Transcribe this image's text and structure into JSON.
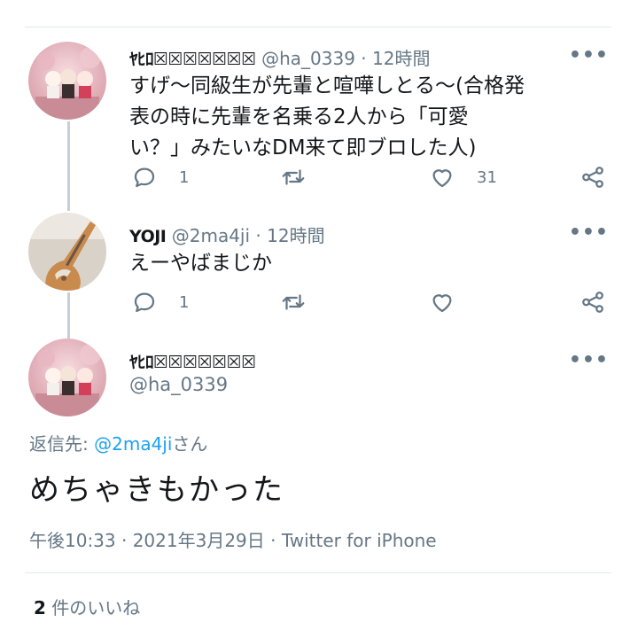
{
  "tweets": [
    {
      "display_name": "ﾔﾋﾛ☒☒☒☒☒☒☒",
      "handle": "@ha_0339",
      "time": "· 12時間",
      "more": "•••",
      "text": [
        "すげ〜同級生が先輩と喧嘩しとる〜(合格発",
        "表の時に先輩を名乗る2人から「可愛",
        "い？」みたいなDM来て即ブロした人)"
      ],
      "reply_count": "1",
      "like_count": "31",
      "avatar": "figurines-avatar"
    },
    {
      "display_name": "YOJI",
      "handle": "@2ma4ji",
      "time": "· 12時間",
      "more": "•••",
      "text": [
        "えーやばまじか"
      ],
      "reply_count": "1",
      "like_count": "",
      "avatar": "bass-guitar-avatar"
    }
  ],
  "main_tweet": {
    "display_name": "ﾔﾋﾛ☒☒☒☒☒☒☒",
    "handle": "@ha_0339",
    "more": "•••",
    "reply_to_label": "返信先: ",
    "reply_to_handle": "@2ma4ji",
    "reply_to_suffix": "さん",
    "text": "めちゃきもかった",
    "timestamp": "午後10:33 · 2021年3月29日 · Twitter for iPhone",
    "likes_count": "2",
    "likes_label": " 件のいいね"
  },
  "colors": {
    "text_primary": "#14171a",
    "text_secondary": "#657786",
    "link": "#1da1f2",
    "thread_line": "#c4cfd6"
  },
  "icons": [
    "reply-icon",
    "retweet-icon",
    "like-icon",
    "share-icon",
    "more-icon"
  ]
}
